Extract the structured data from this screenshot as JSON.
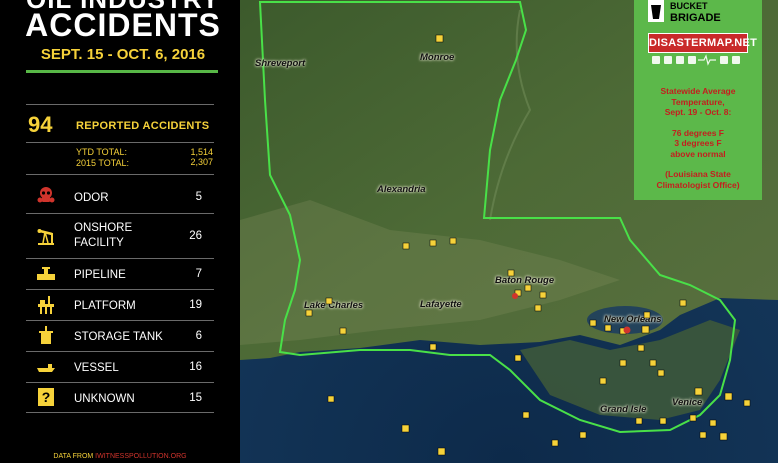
{
  "header": {
    "title_line1": "OIL INDUSTRY",
    "title_line2": "ACCIDENTS",
    "date_range": "SEPT. 15 - OCT. 6, 2016"
  },
  "summary": {
    "reported_count": "94",
    "reported_label": "REPORTED ACCIDENTS",
    "ytd_label": "YTD TOTAL:",
    "ytd_value": "1,514",
    "prev_label": "2015 TOTAL:",
    "prev_value": "2,307"
  },
  "categories": [
    {
      "label": "ODOR",
      "count": "5",
      "icon": "skull-gas-mask-icon",
      "color": "#d0342c"
    },
    {
      "label": "ONSHORE\nFACILITY",
      "count": "26",
      "icon": "pumpjack-icon",
      "color": "#f6d23a"
    },
    {
      "label": "PIPELINE",
      "count": "7",
      "icon": "pipeline-icon",
      "color": "#f6d23a"
    },
    {
      "label": "PLATFORM",
      "count": "19",
      "icon": "platform-icon",
      "color": "#f6d23a"
    },
    {
      "label": "STORAGE TANK",
      "count": "6",
      "icon": "storage-tank-icon",
      "color": "#f6d23a"
    },
    {
      "label": "VESSEL",
      "count": "16",
      "icon": "vessel-icon",
      "color": "#f6d23a"
    },
    {
      "label": "UNKNOWN",
      "count": "15",
      "icon": "question-icon",
      "color": "#f6d23a"
    }
  ],
  "footer": {
    "prefix": "DATA FROM ",
    "source": "IWITNESSPOLLUTION.ORG"
  },
  "map": {
    "cities": [
      "Shreveport",
      "Monroe",
      "Alexandria",
      "Baton Rouge",
      "Lake Charles",
      "Lafayette",
      "New Orleans",
      "Grand Isle",
      "Venice"
    ]
  },
  "branding": {
    "logo_text": "BUCKET BRIGADE",
    "disaster_map": "DISASTERMAP.NET"
  },
  "info": {
    "line1": "Statewide Average",
    "line2": "Temperature,",
    "line3": "Sept. 19 - Oct. 8:",
    "line4": "76 degrees F",
    "line5": "3 degrees F",
    "line6": "above normal",
    "line7": "(Louisiana State",
    "line8": "Climatologist Office)"
  }
}
